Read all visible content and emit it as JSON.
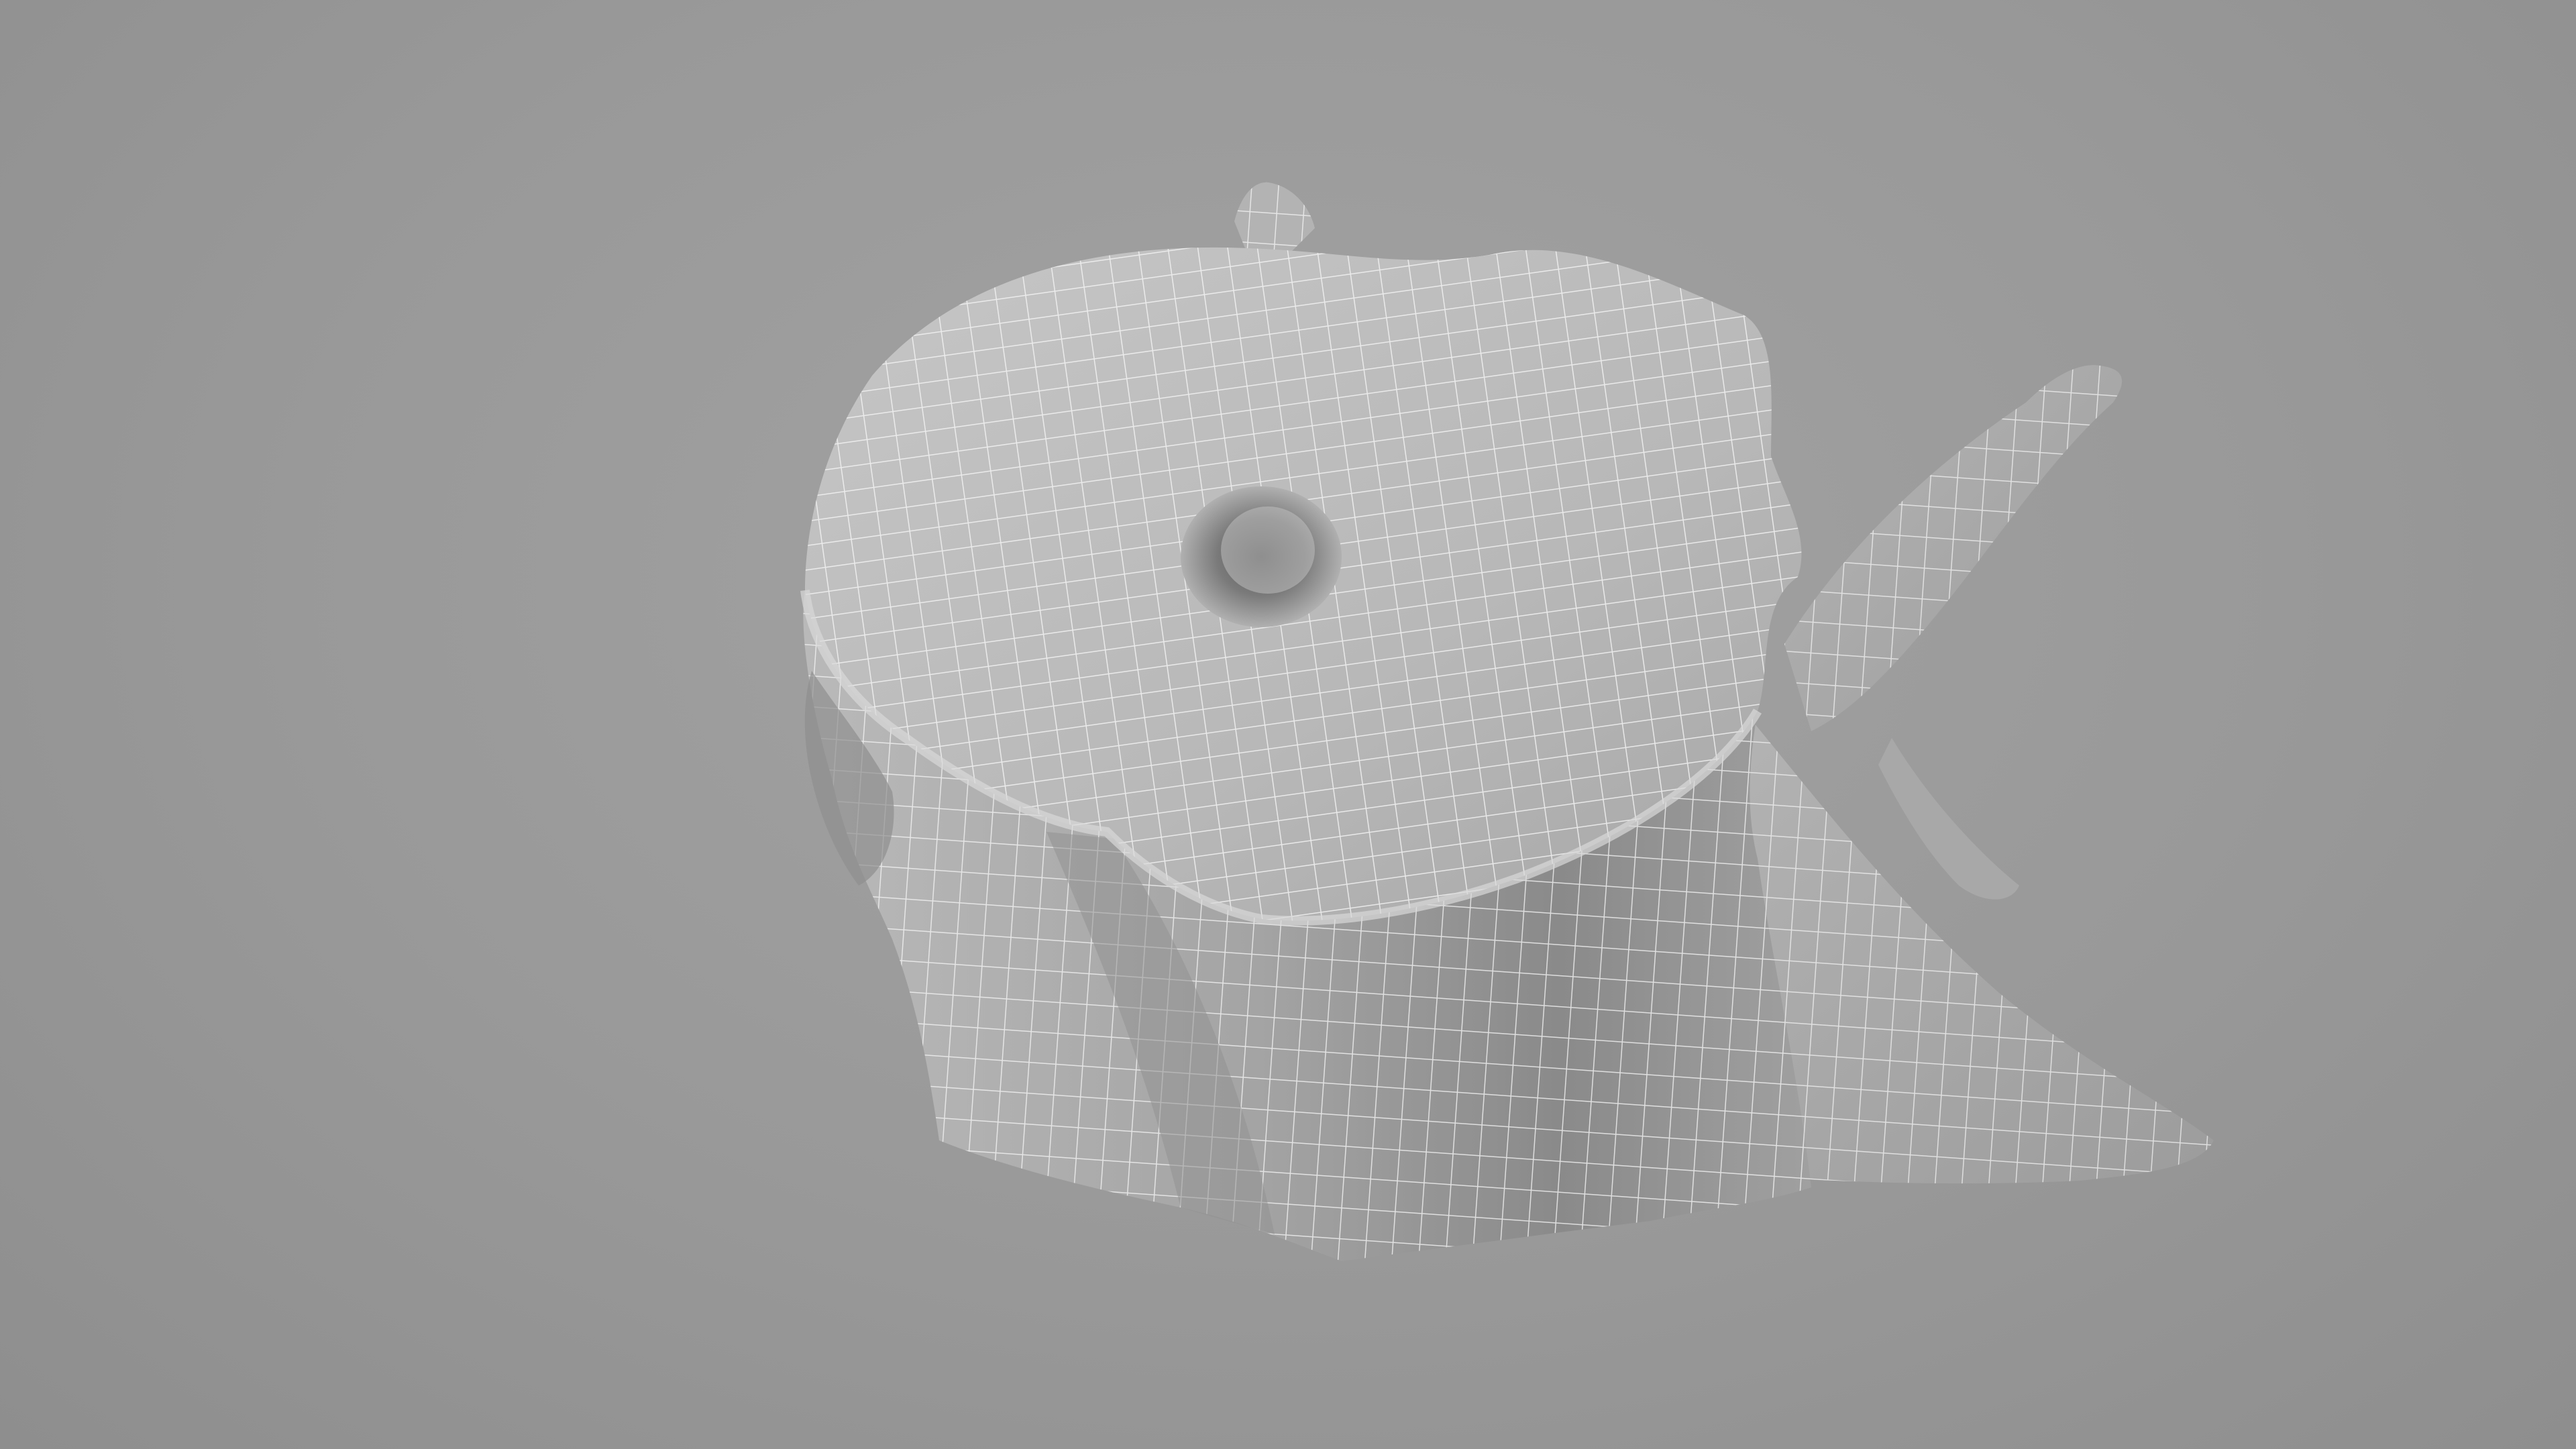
{
  "scene": {
    "subject": "tree-stump-wireframe-mesh",
    "colors": {
      "background": "#9a9a9a",
      "mesh_light": "#c9c9c9",
      "mesh_mid": "#a9a9a9",
      "mesh_shadow": "#6f6f6f",
      "wire": "#f4f4f4"
    }
  }
}
